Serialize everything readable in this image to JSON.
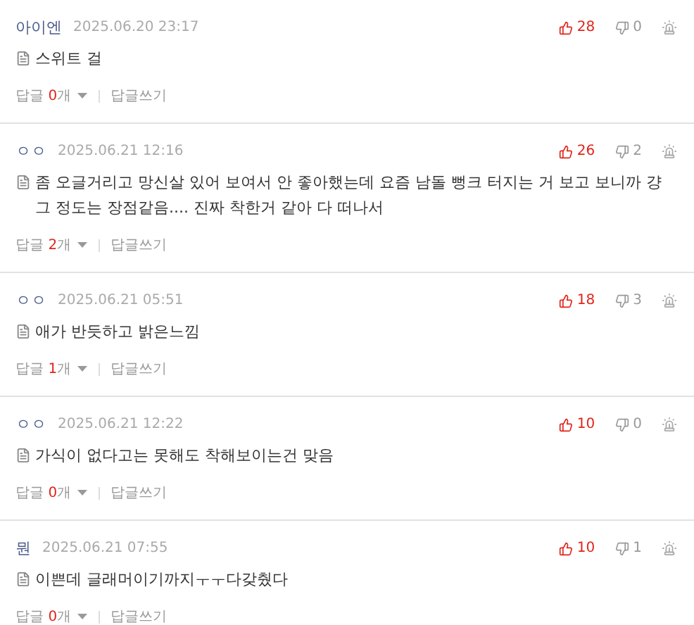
{
  "comments": [
    {
      "author": "아이엔",
      "date": "2025.06.20 23:17",
      "likes": "28",
      "dislikes": "0",
      "text": "스위트 걸",
      "reply_label": "답글",
      "reply_count": "0",
      "reply_unit": "개",
      "write_reply": "답글쓰기"
    },
    {
      "author": "ㅇㅇ",
      "date": "2025.06.21 12:16",
      "likes": "26",
      "dislikes": "2",
      "text": "좀 오글거리고 망신살 있어 보여서 안 좋아했는데 요즘 남돌 뻥크 터지는 거 보고 보니까 걍 그 정도는 장점같음.... 진짜 착한거 같아 다 떠나서",
      "reply_label": "답글",
      "reply_count": "2",
      "reply_unit": "개",
      "write_reply": "답글쓰기"
    },
    {
      "author": "ㅇㅇ",
      "date": "2025.06.21 05:51",
      "likes": "18",
      "dislikes": "3",
      "text": "애가 반듯하고 밝은느낌",
      "reply_label": "답글",
      "reply_count": "1",
      "reply_unit": "개",
      "write_reply": "답글쓰기"
    },
    {
      "author": "ㅇㅇ",
      "date": "2025.06.21 12:22",
      "likes": "10",
      "dislikes": "0",
      "text": "가식이 없다고는 못해도 착해보이는건 맞음",
      "reply_label": "답글",
      "reply_count": "0",
      "reply_unit": "개",
      "write_reply": "답글쓰기"
    },
    {
      "author": "뭔",
      "date": "2025.06.21 07:55",
      "likes": "10",
      "dislikes": "1",
      "text": "이쁜데 글래머이기까지ㅜㅜ다갖췄다",
      "reply_label": "답글",
      "reply_count": "0",
      "reply_unit": "개",
      "write_reply": "답글쓰기"
    }
  ]
}
